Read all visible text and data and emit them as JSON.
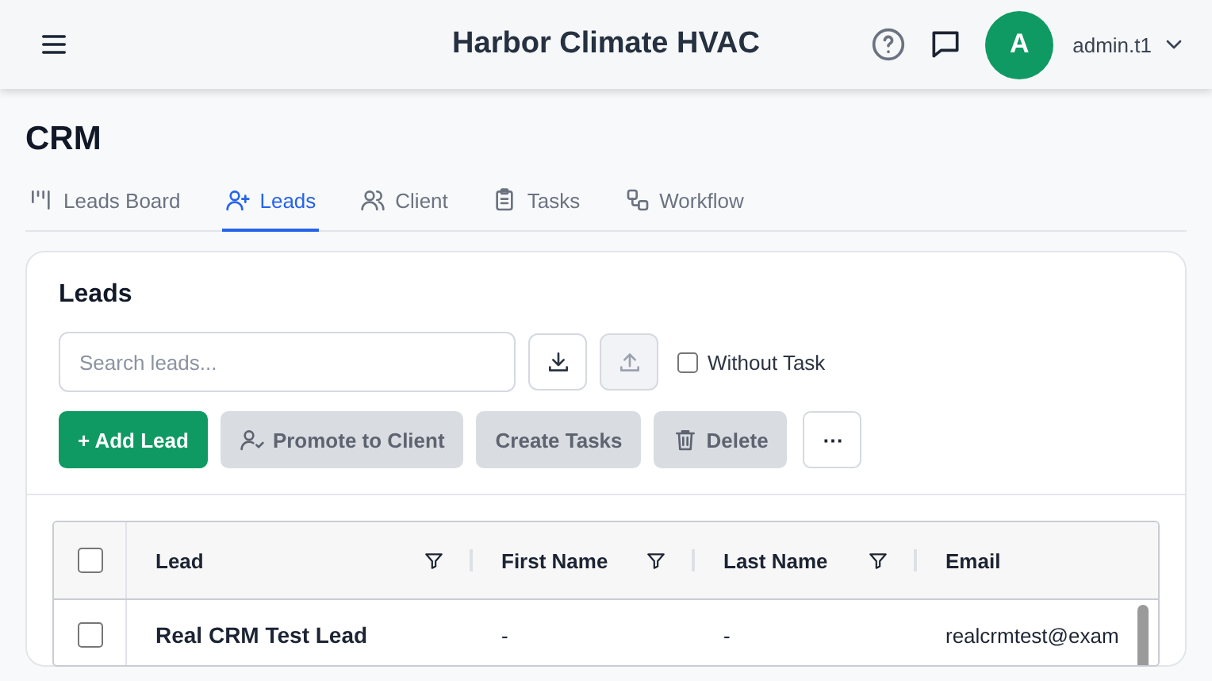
{
  "header": {
    "title": "Harbor Climate HVAC",
    "avatar_initial": "A",
    "username": "admin.t1"
  },
  "page_title": "CRM",
  "tabs": [
    {
      "label": "Leads Board",
      "kind": "board",
      "selected": false
    },
    {
      "label": "Leads",
      "kind": "leads",
      "selected": true
    },
    {
      "label": "Client",
      "kind": "client",
      "selected": false
    },
    {
      "label": "Tasks",
      "kind": "tasks",
      "selected": false
    },
    {
      "label": "Workflow",
      "kind": "workflow",
      "selected": false
    }
  ],
  "card": {
    "title": "Leads",
    "search": {
      "placeholder": "Search leads..."
    },
    "download_disabled": false,
    "upload_disabled": true,
    "without_task": {
      "label": "Without Task",
      "checked": false
    },
    "actions": [
      {
        "label": "+ Add Lead",
        "kind": "primary",
        "disabled": false
      },
      {
        "label": "Promote to Client",
        "kind": "promote",
        "disabled": true
      },
      {
        "label": "Create Tasks",
        "kind": "plain",
        "disabled": true
      },
      {
        "label": "Delete",
        "kind": "delete",
        "disabled": true
      },
      {
        "label": "⋯",
        "kind": "more",
        "disabled": false
      }
    ]
  },
  "table": {
    "all_checked": false,
    "columns": [
      {
        "label": "Lead",
        "filter": true
      },
      {
        "label": "First Name",
        "filter": true
      },
      {
        "label": "Last Name",
        "filter": true
      },
      {
        "label": "Email",
        "filter": false
      }
    ],
    "rows": [
      {
        "selected": false,
        "cells": [
          "Real CRM Test Lead",
          "-",
          "-",
          "realcrmtest@exam"
        ]
      }
    ]
  }
}
